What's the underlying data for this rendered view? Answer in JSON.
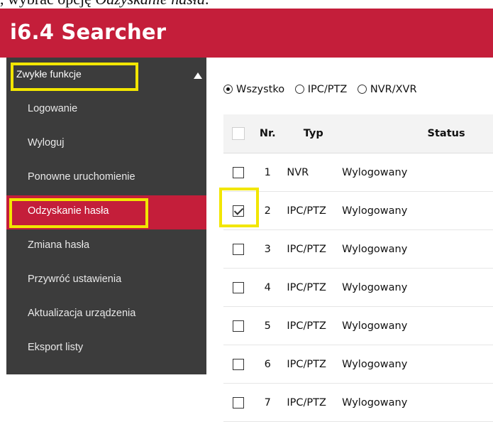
{
  "document": {
    "caption_prefix": ", wybrać opcję ",
    "caption_italic": "Odzyskanie hasła",
    "caption_suffix": "."
  },
  "app": {
    "title": "i6.4 Searcher"
  },
  "sidebar": {
    "group_label": "Zwykłe funkcje",
    "items": [
      {
        "label": "Logowanie"
      },
      {
        "label": "Wyloguj"
      },
      {
        "label": "Ponowne uruchomienie"
      },
      {
        "label": "Odzyskanie hasła",
        "active": true
      },
      {
        "label": "Zmiana hasła"
      },
      {
        "label": "Przywróć ustawienia"
      },
      {
        "label": "Aktualizacja urządzenia"
      },
      {
        "label": "Eksport listy"
      }
    ]
  },
  "filters": {
    "options": [
      {
        "label": "Wszystko",
        "selected": true
      },
      {
        "label": "IPC/PTZ",
        "selected": false
      },
      {
        "label": "NVR/XVR",
        "selected": false
      }
    ]
  },
  "table": {
    "columns": [
      "Nr.",
      "Typ",
      "Status"
    ],
    "rows": [
      {
        "nr": "1",
        "typ": "NVR",
        "status": "Wylogowany",
        "checked": false
      },
      {
        "nr": "2",
        "typ": "IPC/PTZ",
        "status": "Wylogowany",
        "checked": true
      },
      {
        "nr": "3",
        "typ": "IPC/PTZ",
        "status": "Wylogowany",
        "checked": false
      },
      {
        "nr": "4",
        "typ": "IPC/PTZ",
        "status": "Wylogowany",
        "checked": false
      },
      {
        "nr": "5",
        "typ": "IPC/PTZ",
        "status": "Wylogowany",
        "checked": false
      },
      {
        "nr": "6",
        "typ": "IPC/PTZ",
        "status": "Wylogowany",
        "checked": false
      },
      {
        "nr": "7",
        "typ": "IPC/PTZ",
        "status": "Wylogowany",
        "checked": false
      }
    ]
  },
  "colors": {
    "brand": "#c41e3a",
    "sidebar": "#3c3c3c",
    "highlight": "#f2e600"
  }
}
